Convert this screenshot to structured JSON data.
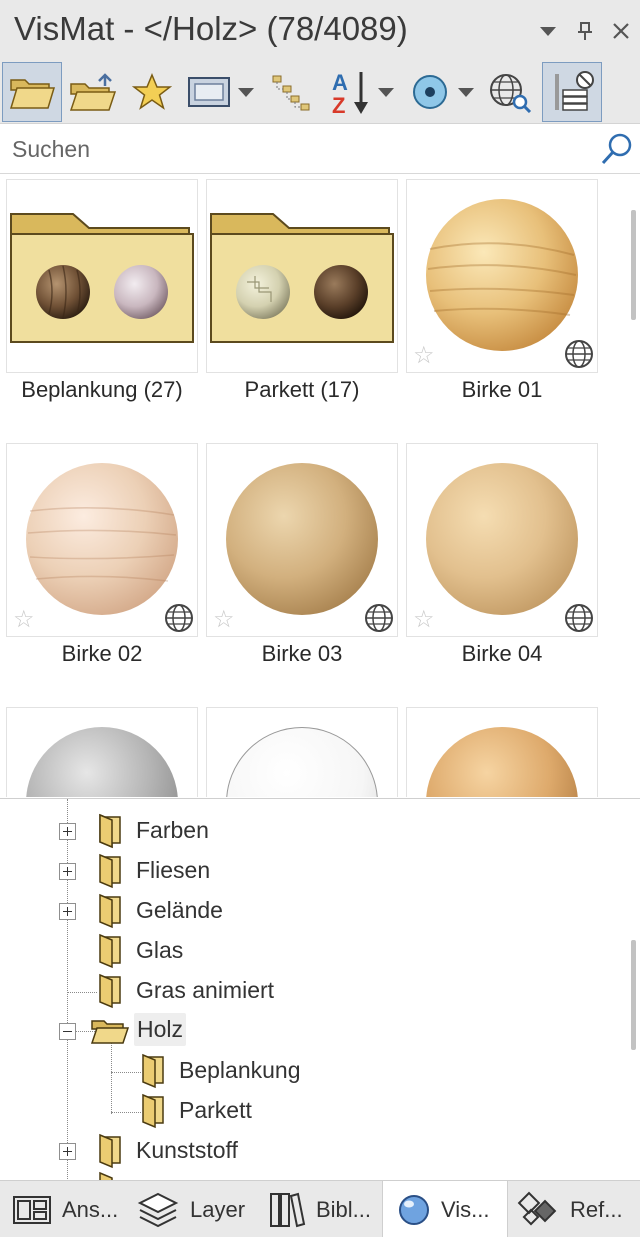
{
  "window": {
    "title": "VisMat - </Holz> (78/4089)"
  },
  "toolbar": {
    "buttons": [
      "open-folder",
      "folder-up",
      "favorites",
      "view-mode",
      "tree-structure",
      "sort-az",
      "material-type",
      "online-search",
      "server-filter"
    ],
    "sort_a": "A",
    "sort_z": "Z"
  },
  "search": {
    "placeholder": "Suchen"
  },
  "grid": {
    "items": [
      {
        "label": "Beplankung (27)",
        "kind": "folder"
      },
      {
        "label": "Parkett (17)",
        "kind": "folder"
      },
      {
        "label": "Birke 01",
        "kind": "material"
      },
      {
        "label": "Birke 02",
        "kind": "material"
      },
      {
        "label": "Birke 03",
        "kind": "material"
      },
      {
        "label": "Birke 04",
        "kind": "material"
      },
      {
        "label": "",
        "kind": "material"
      },
      {
        "label": "",
        "kind": "material"
      },
      {
        "label": "",
        "kind": "material"
      }
    ]
  },
  "tree": {
    "items": [
      {
        "label": "Farben",
        "expander": "plus"
      },
      {
        "label": "Fliesen",
        "expander": "plus"
      },
      {
        "label": "Gelände",
        "expander": "plus"
      },
      {
        "label": "Glas",
        "expander": "none"
      },
      {
        "label": "Gras animiert",
        "expander": "none"
      },
      {
        "label": "Holz",
        "expander": "minus",
        "selected": true
      },
      {
        "label": "Beplankung",
        "expander": "none",
        "child": true
      },
      {
        "label": "Parkett",
        "expander": "none",
        "child": true
      },
      {
        "label": "Kunststoff",
        "expander": "plus"
      }
    ]
  },
  "tabs": [
    {
      "label": "Ans...",
      "icon": "layout-icon"
    },
    {
      "label": "Layer",
      "icon": "layers-icon"
    },
    {
      "label": "Bibl...",
      "icon": "library-icon"
    },
    {
      "label": "Vis...",
      "icon": "sphere-icon",
      "active": true
    },
    {
      "label": "Ref...",
      "icon": "reference-icon"
    }
  ],
  "colors": {
    "accent": "#2f6db0",
    "folder": "#ecd99a",
    "folder_dark": "#d2b45e",
    "panel": "#e9e9e9"
  }
}
